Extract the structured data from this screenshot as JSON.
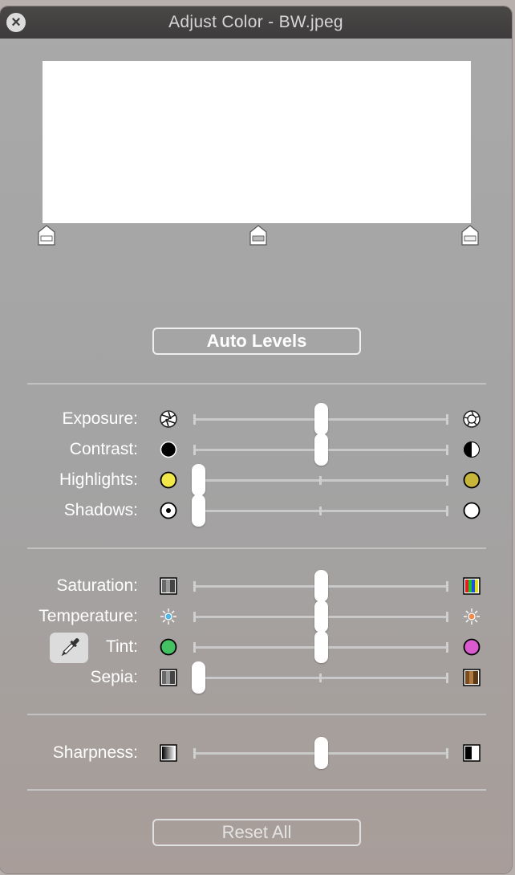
{
  "window": {
    "title": "Adjust Color - BW.jpeg"
  },
  "buttons": {
    "auto_levels": "Auto Levels",
    "reset_all": "Reset All"
  },
  "sliders": {
    "exposure": {
      "label": "Exposure:",
      "value": 0.5
    },
    "contrast": {
      "label": "Contrast:",
      "value": 0.5
    },
    "highlights": {
      "label": "Highlights:",
      "value": 0.0
    },
    "shadows": {
      "label": "Shadows:",
      "value": 0.0
    },
    "saturation": {
      "label": "Saturation:",
      "value": 0.5
    },
    "temperature": {
      "label": "Temperature:",
      "value": 0.5
    },
    "tint": {
      "label": "Tint:",
      "value": 0.5
    },
    "sepia": {
      "label": "Sepia:",
      "value": 0.0
    },
    "sharpness": {
      "label": "Sharpness:",
      "value": 0.5
    }
  },
  "colors": {
    "highlights_low": "#f2e84a",
    "highlights_high": "#c7b63a",
    "tint_low": "#43c163",
    "tint_high": "#d95bcf",
    "temperature_low": "#4fb7e8",
    "temperature_high": "#f08a4b",
    "sepia_high": "#9a6a3a"
  }
}
